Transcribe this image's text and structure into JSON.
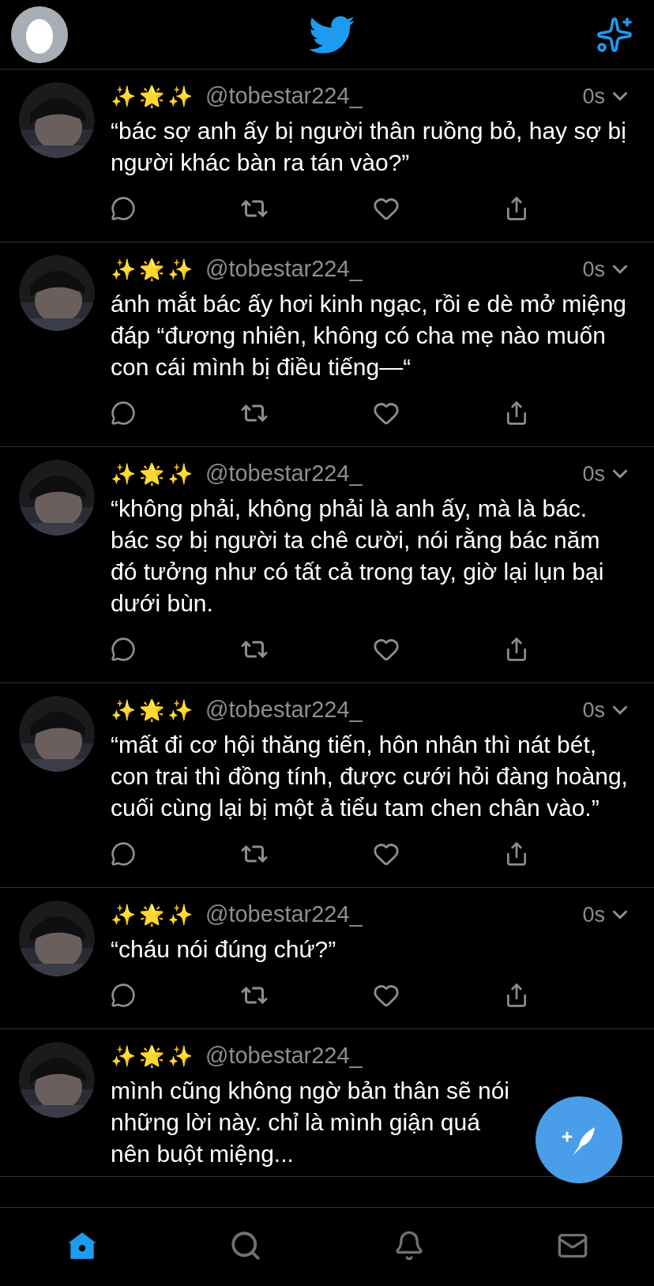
{
  "tabs": [
    {
      "kind": "home",
      "selected": true
    },
    {
      "kind": "search",
      "selected": false
    },
    {
      "kind": "notifications",
      "selected": false
    },
    {
      "kind": "messages",
      "selected": false
    }
  ],
  "tweets": [
    {
      "display_name": "✨🌟✨",
      "handle": "@tobestar224_",
      "time": "0s",
      "text": "“bác sợ anh ấy bị người thân ruồng bỏ, hay sợ bị người khác bàn ra tán vào?”",
      "kind": "full"
    },
    {
      "display_name": "✨🌟✨",
      "handle": "@tobestar224_",
      "time": "0s",
      "text": "ánh mắt bác ấy hơi kinh ngạc, rồi e dè mở miệng đáp “đương nhiên, không có cha mẹ nào muốn con cái mình bị điều tiếng—“",
      "kind": "full"
    },
    {
      "display_name": "✨🌟✨",
      "handle": "@tobestar224_",
      "time": "0s",
      "text": "“không phải, không phải là anh ấy, mà là bác. bác sợ bị người ta chê cười, nói rằng bác năm đó tưởng như có tất cả trong tay, giờ lại lụn bại dưới bùn.",
      "kind": "full"
    },
    {
      "display_name": "✨🌟✨",
      "handle": "@tobestar224_",
      "time": "0s",
      "text": "“mất đi cơ hội thăng tiến, hôn nhân thì nát bét, con trai thì đồng tính, được cưới hỏi đàng hoàng, cuối cùng lại bị một ả tiểu tam chen chân vào.”",
      "kind": "full"
    },
    {
      "display_name": "✨🌟✨",
      "handle": "@tobestar224_",
      "time": "0s",
      "text": "“cháu nói đúng chứ?”",
      "kind": "full"
    },
    {
      "display_name": "✨🌟✨",
      "handle": "@tobestar224_",
      "text": "mình cũng không ngờ bản thân sẽ nói những lời này. chỉ là mình giận quá nên buột miệng...",
      "kind": "truncated"
    }
  ]
}
